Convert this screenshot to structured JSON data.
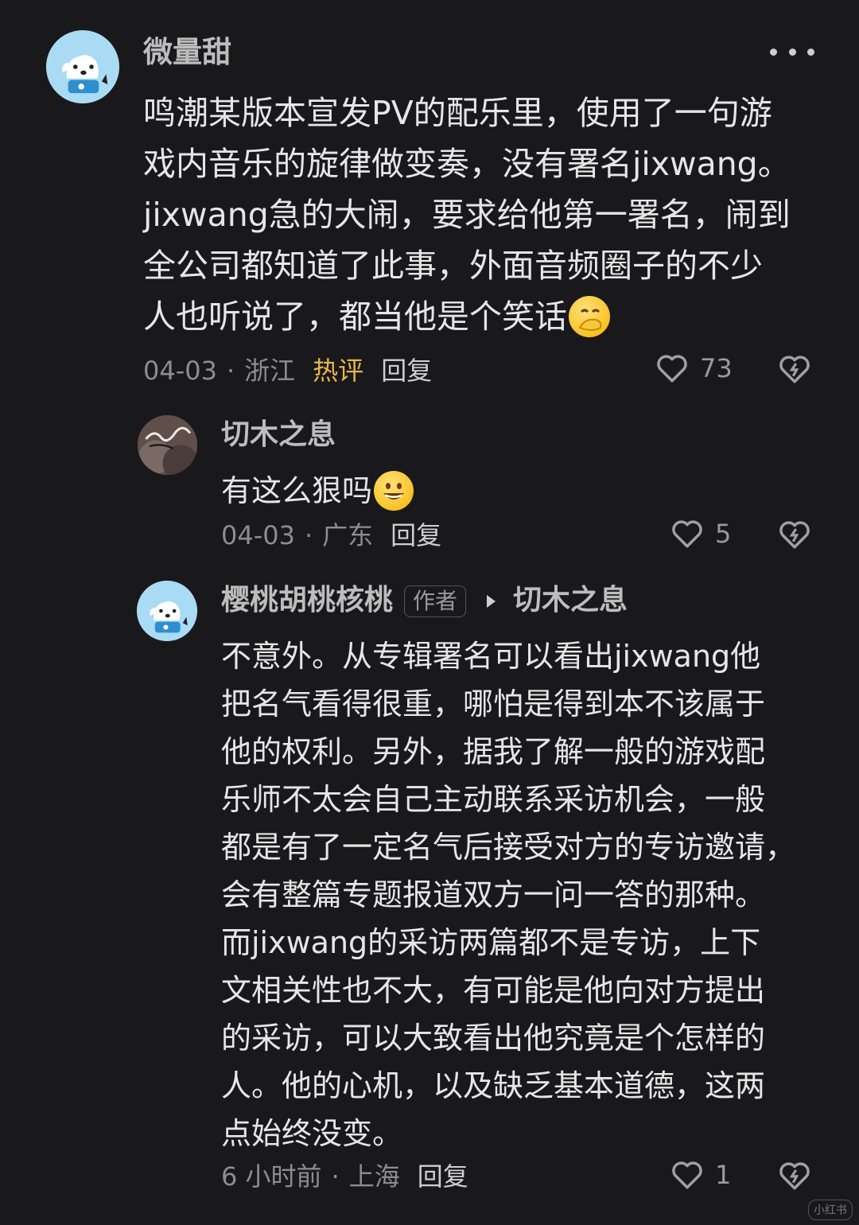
{
  "comments": [
    {
      "author": "微量甜",
      "lines": [
        "鸣潮某版本宣发PV的配乐里，使用了一句游",
        "戏内音乐的旋律做变奏，没有署名jixwang。",
        "jixwang急的大闹，要求给他第一署名，闹到",
        "全公司都知道了此事，外面音频圈子的不少",
        "人也听说了，都当他是个笑话"
      ],
      "date": "04-03",
      "separator": "·",
      "location": "浙江",
      "hot_label": "热评",
      "reply_label": "回复",
      "likes": "73"
    },
    {
      "author": "切木之息",
      "lines": [
        "有这么狠吗"
      ],
      "date": "04-03",
      "separator": "·",
      "location": "广东",
      "reply_label": "回复",
      "likes": "5"
    },
    {
      "author": "樱桃胡桃核桃",
      "badge": "作者",
      "reply_to": "切木之息",
      "lines": [
        "不意外。从专辑署名可以看出jixwang他",
        "把名气看得很重，哪怕是得到本不该属于",
        "他的权利。另外，据我了解一般的游戏配",
        "乐师不太会自己主动联系采访机会，一般",
        "都是有了一定名气后接受对方的专访邀请，",
        "会有整篇专题报道双方一问一答的那种。",
        "而jixwang的采访两篇都不是专访，上下",
        "文相关性也不大，有可能是他向对方提出",
        "的采访，可以大致看出他究竟是个怎样的",
        "人。他的心机，以及缺乏基本道德，这两",
        "点始终没变。"
      ],
      "date": "6 小时前",
      "separator": "·",
      "location": "上海",
      "reply_label": "回复",
      "likes": "1"
    }
  ],
  "icons": {
    "more": "more-dots-icon",
    "like": "heart-icon",
    "share": "share-heart-icon",
    "emoji_1": "hand-over-mouth-emoji",
    "emoji_2": "grinning-face-emoji"
  },
  "watermark": "小红书"
}
